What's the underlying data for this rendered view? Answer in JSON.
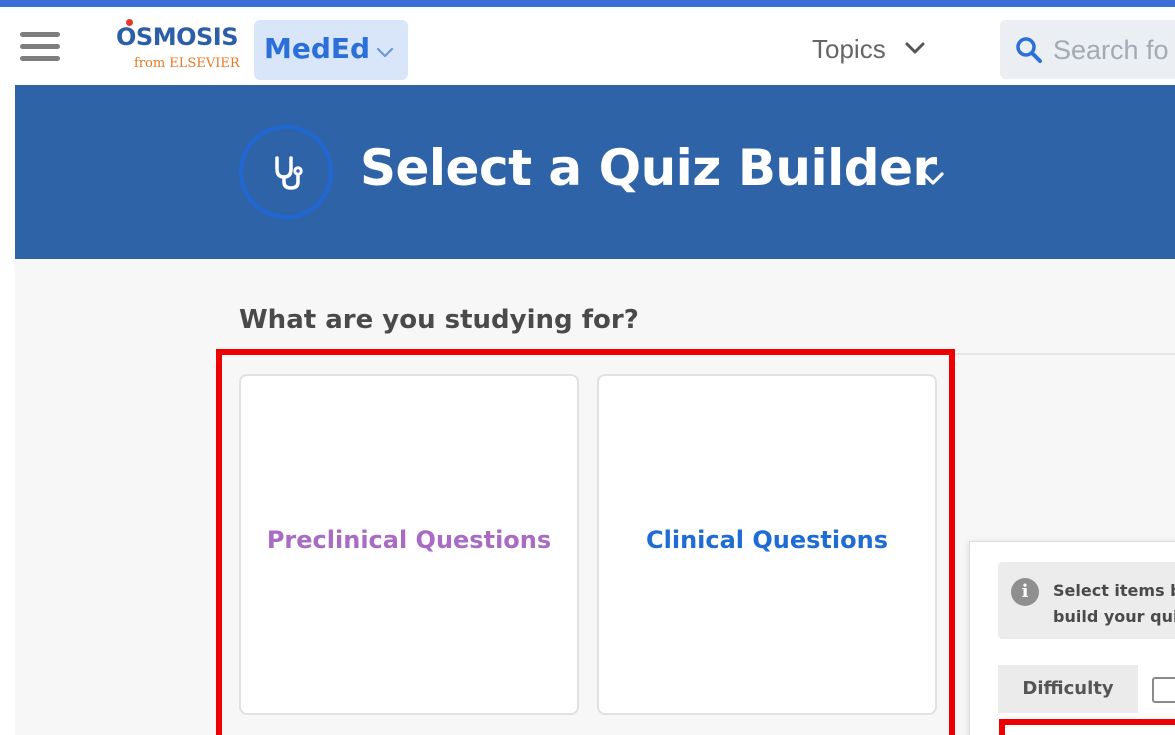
{
  "header": {
    "logo_text": "OSMOSIS",
    "logo_sub": "from ELSEVIER",
    "product_label": "MedEd",
    "topics_label": "Topics",
    "search_placeholder": "Search fo"
  },
  "banner": {
    "title": "Select a Quiz Builder",
    "icon": "stethoscope-icon"
  },
  "main": {
    "question": "What are you studying for?",
    "options": [
      {
        "label": "Preclinical Questions",
        "color": "#a86cc4"
      },
      {
        "label": "Clinical Questions",
        "color": "#1f6dd4"
      }
    ]
  },
  "panel": {
    "info_text": "Select items be\nbuild your quiz",
    "difficulty_label": "Difficulty"
  },
  "colors": {
    "brand_blue": "#2f63a8",
    "highlight_red": "#ee0000",
    "meded_bg": "#d9e6fa"
  }
}
